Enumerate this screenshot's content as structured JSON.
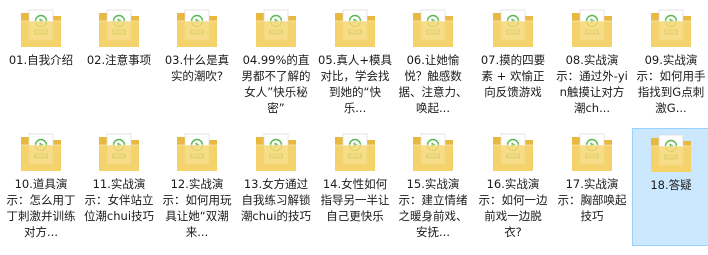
{
  "explorer": {
    "view": "large-icons",
    "selected_index": 17,
    "files": [
      {
        "label": "01.自我介绍",
        "icon": "mp4-folder-icon",
        "badge": "MP4"
      },
      {
        "label": "02.注意事项",
        "icon": "mp4-folder-icon",
        "badge": "MP4"
      },
      {
        "label": "03.什么是真实的潮吹?",
        "icon": "mp4-folder-icon",
        "badge": "MP4"
      },
      {
        "label": "04.99%的直男都不了解的女人”快乐秘密”",
        "icon": "mp4-folder-icon",
        "badge": "MP4"
      },
      {
        "label": "05.真人+模具对比，学会找到她的“快乐...",
        "icon": "mp4-folder-icon",
        "badge": "MP4"
      },
      {
        "label": "06.让她愉悦？触感数据、注意力、唤起...",
        "icon": "mp4-folder-icon",
        "badge": "MP4"
      },
      {
        "label": "07.摸的四要素 + 欢愉正向反馈游戏",
        "icon": "mp4-folder-icon",
        "badge": "MP4"
      },
      {
        "label": "08.实战演示：通过外-yin触摸让对方潮ch...",
        "icon": "mp4-folder-icon",
        "badge": "MP4"
      },
      {
        "label": "09.实战演示：如何用手指找到G点刺激G...",
        "icon": "mp4-folder-icon",
        "badge": "MP4"
      },
      {
        "label": "10.道具演示：怎么用丁丁刺激并训练对方...",
        "icon": "mp4-folder-icon",
        "badge": "MP4"
      },
      {
        "label": "11.实战演示：女伴站立位潮chui技巧",
        "icon": "mp4-folder-icon",
        "badge": "MP4"
      },
      {
        "label": "12.实战演示：如何用玩具让她“双潮来...",
        "icon": "mp4-folder-icon",
        "badge": "MP4"
      },
      {
        "label": "13.女方通过自我练习解锁潮chui的技巧",
        "icon": "mp4-folder-icon",
        "badge": "MP4"
      },
      {
        "label": "14.女性如何指导另一半让自己更快乐",
        "icon": "mp4-folder-icon",
        "badge": "MP4"
      },
      {
        "label": "15.实战演示：建立情绪之暖身前戏、安抚...",
        "icon": "mp4-folder-icon",
        "badge": "MP4"
      },
      {
        "label": "16.实战演示：如何一边前戏一边脱衣?",
        "icon": "mp4-folder-icon",
        "badge": "MP4"
      },
      {
        "label": "17.实战演示：胸部唤起技巧",
        "icon": "mp4-folder-icon",
        "badge": "MP4"
      },
      {
        "label": "18.答疑",
        "icon": "mp4-folder-icon",
        "badge": "MP4"
      }
    ]
  },
  "colors": {
    "folder_body": "#f7d774",
    "folder_back": "#e9b840",
    "paper": "#ffffff",
    "badge_bg": "#5fbe5a",
    "play_icon": "#57b84f",
    "selection_bg": "#cce8ff",
    "selection_border": "#99d1ff"
  }
}
